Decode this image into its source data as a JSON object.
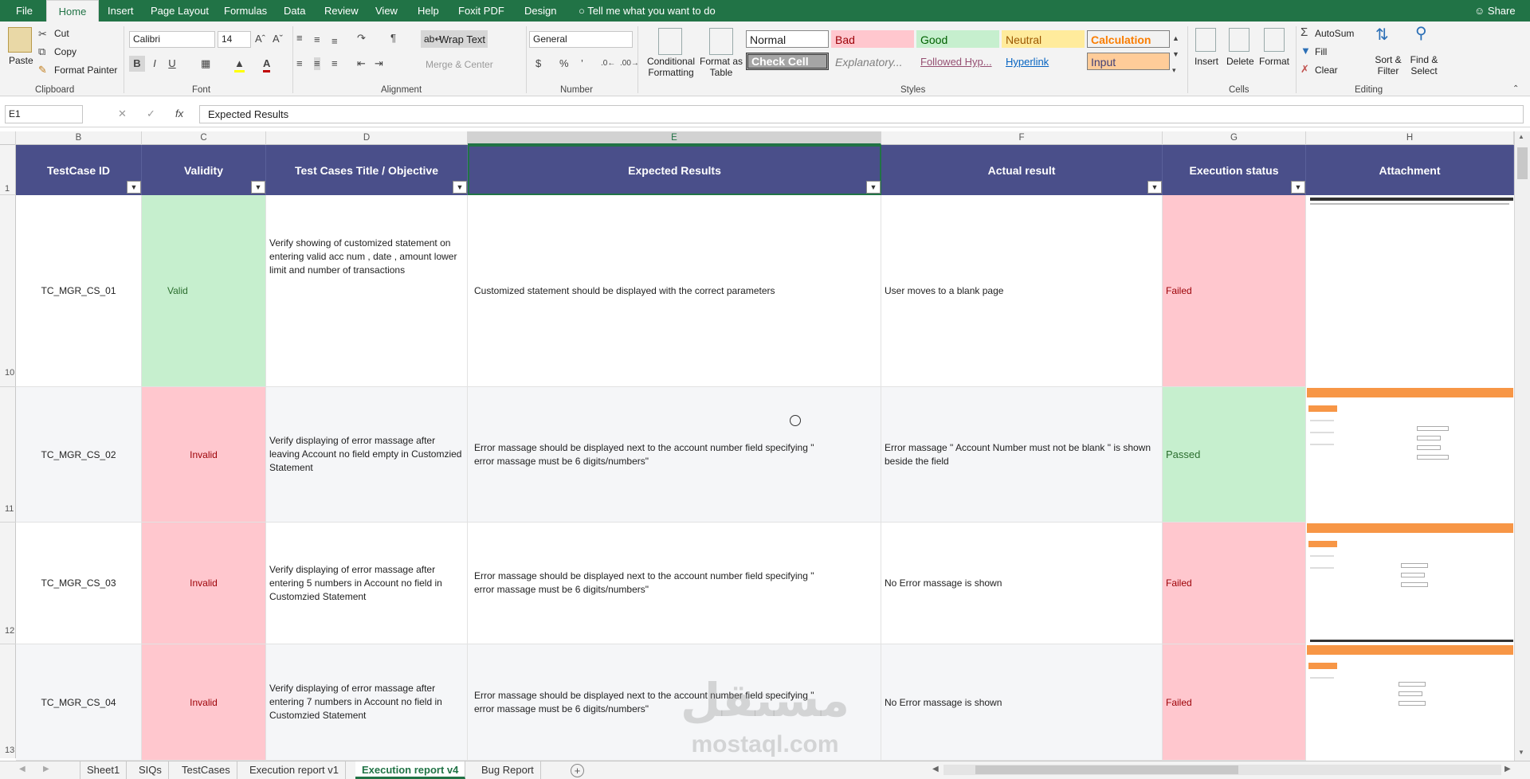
{
  "menu_tabs": [
    "File",
    "Home",
    "Insert",
    "Page Layout",
    "Formulas",
    "Data",
    "Review",
    "View",
    "Help",
    "Foxit PDF",
    "Design"
  ],
  "tell_me": "Tell me what you want to do",
  "share": "Share",
  "clipboard": {
    "paste": "Paste",
    "cut": "Cut",
    "copy": "Copy",
    "format_painter": "Format Painter",
    "label": "Clipboard"
  },
  "font": {
    "name": "Calibri",
    "size": "14",
    "bold": "B",
    "italic": "I",
    "underline": "U",
    "label": "Font"
  },
  "alignment": {
    "wrap_text": "Wrap Text",
    "merge_center": "Merge & Center",
    "label": "Alignment"
  },
  "number": {
    "format": "General",
    "currency": "$",
    "percent": "%",
    "comma": "’",
    "label": "Number"
  },
  "styles": {
    "conditional": "Conditional Formatting",
    "format_table": "Format as Table",
    "cells": [
      {
        "text": "Normal"
      },
      {
        "text": "Bad"
      },
      {
        "text": "Good"
      },
      {
        "text": "Neutral"
      },
      {
        "text": "Calculation"
      },
      {
        "text": "Check Cell"
      },
      {
        "text": "Explanatory..."
      },
      {
        "text": "Followed Hyp..."
      },
      {
        "text": "Hyperlink"
      },
      {
        "text": "Input"
      }
    ],
    "label": "Styles"
  },
  "cells_group": {
    "insert": "Insert",
    "delete": "Delete",
    "format": "Format",
    "label": "Cells"
  },
  "editing": {
    "autosum": "AutoSum",
    "fill": "Fill",
    "clear": "Clear",
    "sort": "Sort & Filter",
    "find": "Find & Select",
    "label": "Editing"
  },
  "formula_bar": {
    "name_box": "E1",
    "value": "Expected Results",
    "fx": "fx"
  },
  "columns": [
    "B",
    "C",
    "D",
    "E",
    "F",
    "G",
    "H"
  ],
  "headers": [
    "TestCase ID",
    "Validity",
    "Test Cases Title / Objective",
    "Expected Results",
    "Actual result",
    "Execution status",
    "Attachment"
  ],
  "rows": [
    {
      "num": "10",
      "id": "TC_MGR_CS_01",
      "validity": "Valid",
      "title": "Verify showing of customized statement on entering valid acc num , date , amount lower limit and number of transactions",
      "expected": "Customized statement should be displayed with the correct parameters",
      "actual": "User moves to a blank page",
      "status": "Failed"
    },
    {
      "num": "11",
      "id": "TC_MGR_CS_02",
      "validity": "Invalid",
      "title": "Verify displaying of error massage after leaving Account no field empty in Customzied Statement",
      "expected": "Error massage should be displayed next to the account number field specifying \" error massage must be 6 digits/numbers\"",
      "actual": "Error massage \" Account Number must not be blank \" is shown beside the field",
      "status": "Passed"
    },
    {
      "num": "12",
      "id": "TC_MGR_CS_03",
      "validity": "Invalid",
      "title": "Verify displaying of error massage after entering 5 numbers in Account no field in Customzied Statement",
      "expected": "Error massage should be displayed next to the account number field specifying \" error massage must be 6 digits/numbers\"",
      "actual": "No Error massage is shown",
      "status": "Failed"
    },
    {
      "num": "13",
      "id": "TC_MGR_CS_04",
      "validity": "Invalid",
      "title": "Verify displaying of error massage after entering 7 numbers in Account no field in Customzied Statement",
      "expected": "Error massage should be displayed next to the account number field specifying \" error massage must be 6 digits/numbers\"",
      "actual": "No Error massage is shown",
      "status": "Failed"
    }
  ],
  "row_header_1": "1",
  "sheet_tabs": [
    "Sheet1",
    "SIQs",
    "TestCases",
    "Execution report v1",
    "Execution report v4",
    "Bug Report"
  ],
  "active_sheet": "Execution report v4",
  "add_sheet": "+",
  "watermark": {
    "arabic": "مستقل",
    "latin": "mostaql.com"
  },
  "colors": {
    "ribbon": "#217346",
    "header_fill": "#4a4f8a",
    "good": "#c6efce",
    "bad": "#ffc7ce",
    "neutral": "#ffeb9c"
  }
}
